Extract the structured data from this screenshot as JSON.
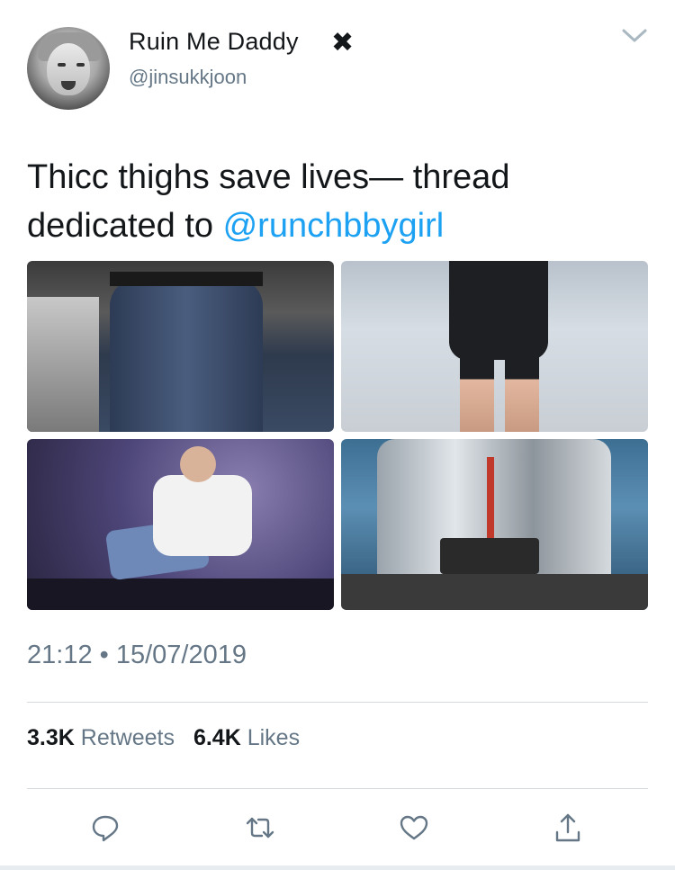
{
  "user": {
    "display_name": "Ruin Me Daddy",
    "badge_glyph": "✖",
    "handle": "@jinsukkjoon"
  },
  "tweet": {
    "text_before_mention": "Thicc thighs save lives— thread dedicated to ",
    "mention": "@runchbbygirl"
  },
  "media": {
    "photo_count": 4
  },
  "meta": {
    "timestamp": "21:12 • 15/07/2019"
  },
  "stats": {
    "retweets_count": "3.3K",
    "retweets_label": "Retweets",
    "likes_count": "6.4K",
    "likes_label": "Likes"
  },
  "actions": [
    "reply-icon",
    "retweet-icon",
    "like-icon",
    "share-icon"
  ],
  "colors": {
    "link": "#1da1f2",
    "secondary_text": "#657786",
    "primary_text": "#14171a",
    "divider": "#d5d9dc"
  }
}
